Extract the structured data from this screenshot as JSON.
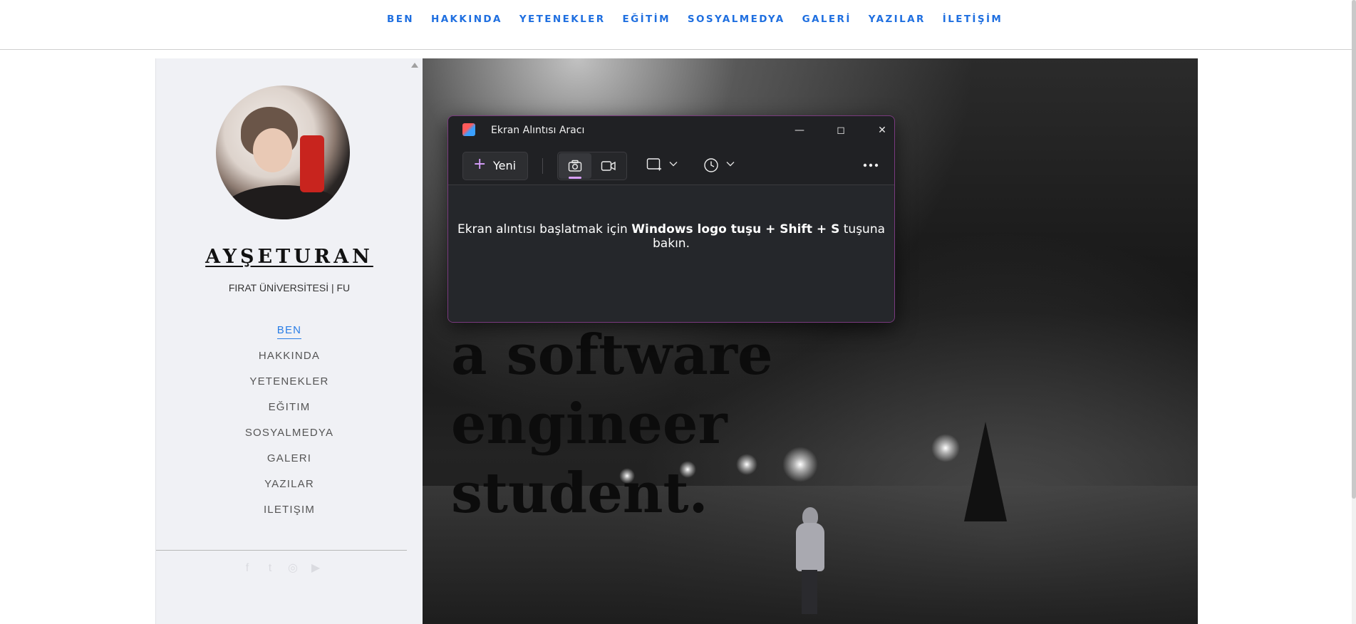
{
  "topnav": {
    "items": [
      "BEN",
      "HAKKINDA",
      "YETENEKLER",
      "EĞİTİM",
      "SOSYALMEDYA",
      "GALERİ",
      "YAZILAR",
      "İLETİŞİM"
    ]
  },
  "sidebar": {
    "name": "AYŞETURAN",
    "school": "FIRAT ÜNİVERSİTESİ | FU",
    "menu": [
      "BEN",
      "HAKKINDA",
      "YETENEKLER",
      "EĞITIM",
      "SOSYALMEDYA",
      "GALERI",
      "YAZILAR",
      "ILETIŞIM"
    ],
    "active_item": "BEN",
    "social_icons": [
      "facebook-icon",
      "twitter-icon",
      "instagram-icon",
      "youtube-icon"
    ]
  },
  "hero": {
    "line1": "a software",
    "line2": "engineer",
    "line3": "student."
  },
  "snipping_tool": {
    "title": "Ekran Alıntısı Aracı",
    "new_label": "Yeni",
    "hint_pre": "Ekran alıntısı başlatmak için ",
    "hint_bold": "Windows logo tuşu + Shift + S",
    "hint_post": " tuşuna bakın.",
    "accent_color": "#d9a0ff",
    "border_color": "#7a3a7f"
  },
  "colors": {
    "nav_link": "#1f6fe0",
    "sidebar_bg": "#f0f1f5",
    "active_link": "#2a7ee6"
  }
}
